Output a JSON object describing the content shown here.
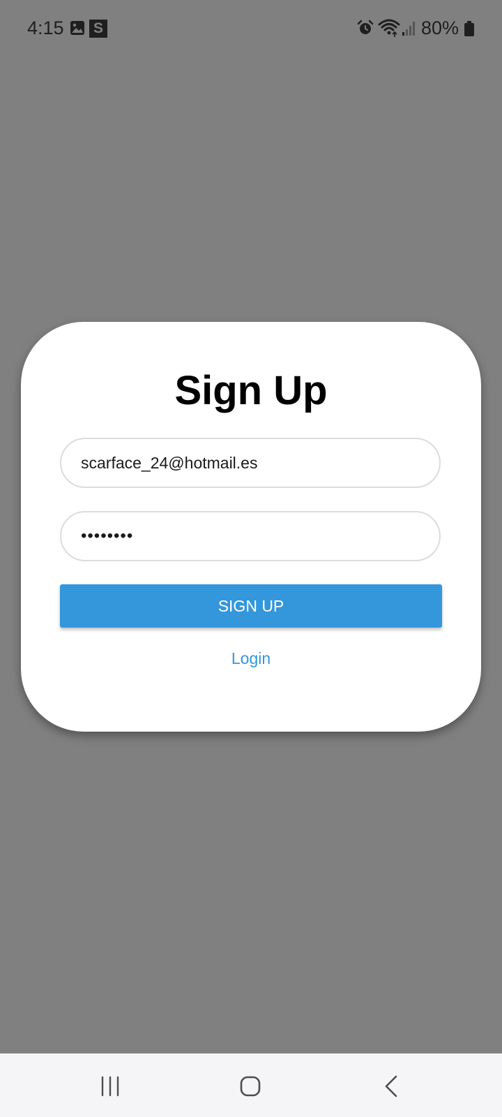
{
  "status_bar": {
    "time": "4:15",
    "s_badge": "S",
    "battery": "80%",
    "icons": [
      "gallery-icon",
      "s-icon",
      "alarm-icon",
      "wifi-icon",
      "signal-icon",
      "battery-icon"
    ]
  },
  "form": {
    "title": "Sign Up",
    "email_value": "scarface_24@hotmail.es",
    "password_value": "••••••••",
    "signup_label": "SIGN UP",
    "login_label": "Login"
  },
  "nav_bar": {
    "icons": [
      "recent-apps-icon",
      "home-icon",
      "back-icon"
    ]
  },
  "colors": {
    "background": "#808080",
    "card": "#ffffff",
    "accent": "#3497db",
    "nav_bar": "#f5f5f7"
  }
}
